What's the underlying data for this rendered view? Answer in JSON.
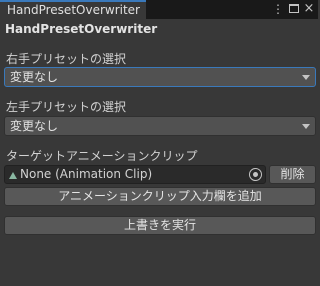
{
  "tab": {
    "title": "HandPresetOverwriter",
    "kebab_glyph": "⋮",
    "close_glyph": "×"
  },
  "panel": {
    "title": "HandPresetOverwriter",
    "right_hand": {
      "label": "右手プリセットの選択",
      "value": "変更なし"
    },
    "left_hand": {
      "label": "左手プリセットの選択",
      "value": "変更なし"
    },
    "clip": {
      "label": "ターゲットアニメーションクリップ",
      "value": "None (Animation Clip)",
      "delete_label": "削除"
    },
    "add_clip_label": "アニメーションクリップ入力欄を追加",
    "execute_label": "上書きを実行"
  },
  "colors": {
    "background": "#383838",
    "accent": "#3a79bb"
  }
}
